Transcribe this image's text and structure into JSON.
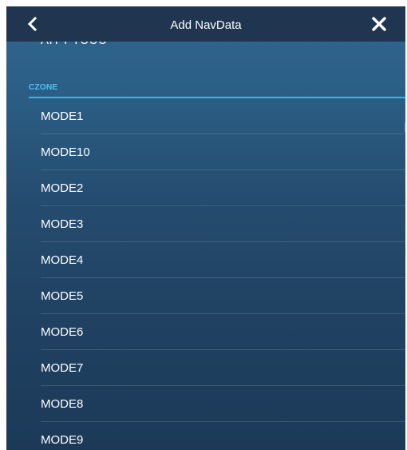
{
  "header": {
    "title": "Add NavData",
    "back_icon": "chevron-left-icon",
    "close_icon": "close-icon"
  },
  "scrolled_item_label": "AIT PTUUU",
  "section": {
    "title": "CZONE"
  },
  "items": [
    {
      "label": "MODE1"
    },
    {
      "label": "MODE10"
    },
    {
      "label": "MODE2"
    },
    {
      "label": "MODE3"
    },
    {
      "label": "MODE4"
    },
    {
      "label": "MODE5"
    },
    {
      "label": "MODE6"
    },
    {
      "label": "MODE7"
    },
    {
      "label": "MODE8"
    },
    {
      "label": "MODE9"
    }
  ],
  "colors": {
    "header_bg": "#1f3550",
    "accent": "#3ab4e6",
    "section_text": "#4fc3f7"
  }
}
